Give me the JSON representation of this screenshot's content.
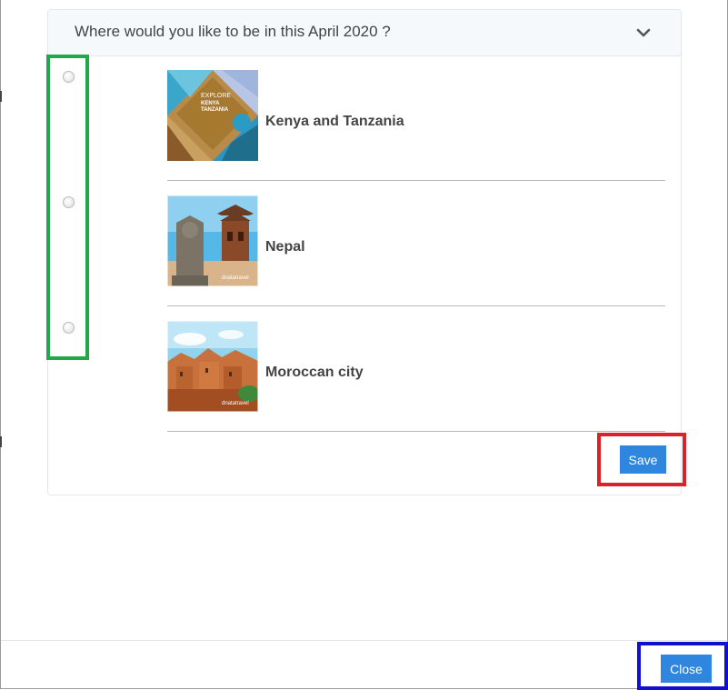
{
  "question": {
    "text": "Where would you like to be in this April 2020 ?",
    "toggle_icon": "chevron-down-icon"
  },
  "options": [
    {
      "label": "Kenya and Tanzania",
      "selected": false,
      "thumbnail_text": [
        "EXPLORE",
        "KENYA",
        "TANZANIA"
      ]
    },
    {
      "label": "Nepal",
      "selected": false,
      "thumbnail_text": [
        "dnatatravel"
      ]
    },
    {
      "label": "Moroccan city",
      "selected": false,
      "thumbnail_text": [
        "dnatatravel"
      ]
    }
  ],
  "buttons": {
    "save": "Save",
    "close": "Close"
  },
  "colors": {
    "button": "#2e86de",
    "highlight_radios": "#21a84b",
    "highlight_save": "#d9222a",
    "highlight_close": "#1010d0"
  }
}
